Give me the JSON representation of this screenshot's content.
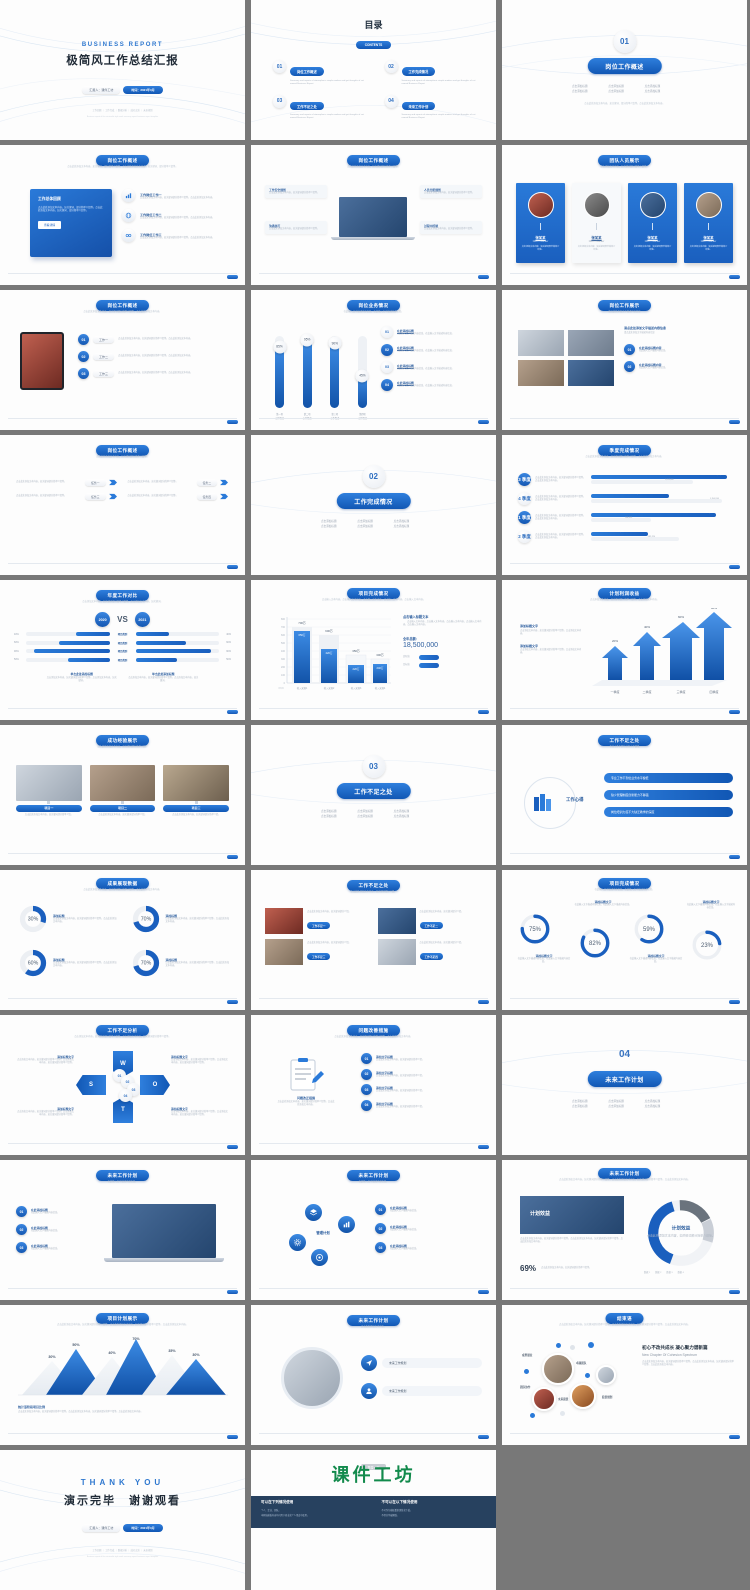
{
  "deck": {
    "background_color": "#787878",
    "accent_blue": "#1f6fd0",
    "accent_dark": "#1157b4"
  },
  "slides": [
    {
      "id": "title",
      "type": "cover",
      "eng_title": "BUSINESS REPORT",
      "cn_title": "极简风工作总结汇报",
      "pill_left": "汇报人：课件工坊",
      "pill_right": "时间：2021年3月",
      "footer": "工作回顾 ｜ 工作完成 ｜ 数据分析 ｜ 成功之处 ｜ 未来规划",
      "footer_sub": "Business report of the minimalist style work summary report business report template"
    },
    {
      "id": "contents",
      "type": "toc",
      "title": "目录",
      "badge": "CONTENTS",
      "items": [
        {
          "num": "01",
          "label": "岗位工作概述",
          "desc": "Summary and reports of atmospheric simple modern and get thoughts of cat named Business Report"
        },
        {
          "num": "02",
          "label": "工作完成情况",
          "desc": "Summary and reports of atmospheric simple modern and get thoughts of cat named Business Report"
        },
        {
          "num": "03",
          "label": "工作不足之处",
          "desc": "Summary and reports of atmospheric simple modern and get thoughts of cat named Business Report"
        },
        {
          "num": "04",
          "label": "未来工作计划",
          "desc": "Summary and reports of atmospheric simple modern and get thoughts of cat named Business Report"
        }
      ]
    },
    {
      "id": "section-01",
      "type": "section",
      "num": "01",
      "title": "岗位工作概述",
      "bullets": [
        "点击添加标题",
        "点击添加标题",
        "点击添加标题",
        "点击添加标题",
        "点击添加标题",
        "点击添加标题"
      ],
      "desc": "点击此处添加文本内容，如关键词、部分简单介绍等。点击此处添加文本内容。"
    },
    {
      "id": "job-overview-card",
      "type": "content",
      "title": "岗位工作概述",
      "card_title": "工作总体回顾",
      "card_text": "点击此处添加文本内容，如关键词、部分简单介绍等。点击此处添加文本内容，如关键词、部分简单介绍等。",
      "card_btn": "查看详情",
      "rows": [
        {
          "label": "工作岗位工作一",
          "desc": "点击此处添加文本内容，如关键词部分简单介绍等。点击此处添加文本内容。",
          "icon": "chart-icon"
        },
        {
          "label": "工作岗位工作二",
          "desc": "点击此处添加文本内容，如关键词部分简单介绍等。点击此处添加文本内容。",
          "icon": "globe-icon"
        },
        {
          "label": "工作岗位工作三",
          "desc": "点击此处添加文本内容，如关键词部分简单介绍等。点击此处添加文本内容。",
          "icon": "link-icon"
        }
      ]
    },
    {
      "id": "job-overview-laptop",
      "type": "content",
      "title": "岗位工作概述",
      "callouts": [
        {
          "label": "工作安全规划",
          "desc": "点击此处添加文本内容，如关键词部分简单介绍等。"
        },
        {
          "label": "人员分配规划",
          "desc": "点击此处添加文本内容，如关键词部分简单介绍等。"
        },
        {
          "label": "沟通技巧",
          "desc": "点击此处添加文本内容，如关键词部分简单介绍等。"
        },
        {
          "label": "过程中控制",
          "desc": "点击此处添加文本内容，如关键词部分简单介绍等。"
        }
      ]
    },
    {
      "id": "team",
      "type": "team",
      "title": "团队人员展示",
      "members": [
        {
          "name": "张某某",
          "role": "CEO / Founder",
          "desc": "点击添加文本内容，如关键词部分简单介绍等。",
          "highlight": true
        },
        {
          "name": "张某某",
          "role": "CEO / Founder",
          "desc": "点击添加文本内容，如关键词部分简单介绍等。",
          "highlight": false
        },
        {
          "name": "张某某",
          "role": "CEO / Founder",
          "desc": "点击添加文本内容，如关键词部分简单介绍等。",
          "highlight": true
        },
        {
          "name": "张某某",
          "role": "CEO / Founder",
          "desc": "点击添加文本内容，如关键词部分简单介绍等。",
          "highlight": true
        }
      ]
    },
    {
      "id": "job-overview-tablet",
      "type": "content",
      "title": "岗位工作概述",
      "rows": [
        {
          "num": "01",
          "label": "工作一",
          "desc": "点击此处添加文本内容，如关键词部分简单介绍等。点击此处添加文本内容。"
        },
        {
          "num": "02",
          "label": "工作二",
          "desc": "点击此处添加文本内容，如关键词部分简单介绍等。点击此处添加文本内容。"
        },
        {
          "num": "03",
          "label": "工作三",
          "desc": "点击此处添加文本内容，如关键词部分简单介绍等。点击此处添加文本内容。"
        }
      ]
    },
    {
      "id": "business-sliders",
      "type": "chart",
      "title": "岗位业务情况",
      "chart_data": {
        "type": "bar",
        "title": "岗位业务情况",
        "categories": [
          "第一项\n工作概述",
          "第二项\n工作概述",
          "第三项\n工作概述",
          "第四项\n工作概述"
        ],
        "values": [
          85,
          95,
          90,
          45
        ],
        "value_labels": [
          "85%",
          "95%",
          "90%",
          "45%"
        ],
        "ylim": [
          0,
          100
        ],
        "ylabel": "",
        "xlabel": ""
      },
      "list": [
        {
          "num": "01",
          "label": "在此添加标题",
          "desc": "在此输入文字描述内容信息，在此输入文字描述内容信息。"
        },
        {
          "num": "02",
          "label": "在此添加标题",
          "desc": "在此输入文字描述内容信息，在此输入文字描述内容信息。"
        },
        {
          "num": "03",
          "label": "在此添加标题",
          "desc": "在此输入文字描述内容信息，在此输入文字描述内容信息。"
        },
        {
          "num": "04",
          "label": "在此添加标题",
          "desc": "在此输入文字描述内容信息，在此输入文字描述内容信息。"
        }
      ]
    },
    {
      "id": "job-photos",
      "type": "content",
      "title": "岗位工作展示",
      "heading": "请点此处添加文字描述内容信息",
      "rows": [
        {
          "num": "01",
          "label": "在此添加标题内容",
          "desc": "在此输入文字描述内容信息。"
        },
        {
          "num": "02",
          "label": "在此添加标题内容",
          "desc": "在此输入文字描述内容信息。"
        }
      ]
    },
    {
      "id": "job-arrows",
      "type": "content",
      "title": "岗位工作概述",
      "rows": [
        {
          "label": "任务一",
          "desc": "点击此处添加文本内容，如关键词部分简单介绍等。"
        },
        {
          "label": "任务二",
          "desc": "点击此处添加文本内容，如关键词部分简单介绍等。"
        },
        {
          "label": "任务三",
          "desc": "点击此处添加文本内容，如关键词部分简单介绍等。"
        },
        {
          "label": "任务四",
          "desc": "点击此处添加文本内容，如关键词部分简单介绍等。"
        }
      ]
    },
    {
      "id": "section-02",
      "type": "section",
      "num": "02",
      "title": "工作完成情况",
      "bullets": [
        "点击添加标题",
        "点击添加标题",
        "点击添加标题",
        "点击添加标题",
        "点击添加标题",
        "点击添加标题"
      ]
    },
    {
      "id": "quarter-completion",
      "type": "chart",
      "title": "季度完成情况",
      "chart_data": {
        "type": "bar",
        "title": "季度完成情况",
        "orientation": "horizontal",
        "categories": [
          "3 季度",
          "4 季度",
          "1 季度",
          "2 季度"
        ],
        "series": [
          {
            "name": "实际完成",
            "values": [
              96,
              55,
              88,
              40
            ],
            "labels": [
              "1,247,448",
              "533,282",
              "861,458",
              "402,128"
            ]
          },
          {
            "name": "计划目标",
            "values": [
              72,
              92,
              42,
              62
            ],
            "labels": [
              "1,058,880",
              "1,156,934",
              "586,331",
              "482,224"
            ]
          }
        ],
        "ylim": [
          0,
          100
        ]
      },
      "rows_desc": "点击此处添加文本内容，如关键词部分简单介绍等。点击此处添加文本内容。"
    },
    {
      "id": "annual-vs",
      "type": "chart",
      "title": "年度工作对比",
      "chart_data": {
        "type": "bar",
        "title": "年度工作对比",
        "orientation": "horizontal-mirror",
        "legend": [
          "2020",
          "2021"
        ],
        "categories": [
          "项目类别",
          "项目类别",
          "项目类别",
          "项目类别"
        ],
        "series": [
          {
            "name": "2020",
            "values": [
              40,
              60,
              90,
              50
            ],
            "labels": [
              "40%",
              "60%",
              "90%",
              "50%"
            ]
          },
          {
            "name": "2021",
            "values": [
              40,
              60,
              90,
              50
            ],
            "labels": [
              "40%",
              "60%",
              "90%",
              "50%"
            ]
          }
        ],
        "ylim": [
          0,
          100
        ]
      },
      "left_head": "单击此处添加标题",
      "right_head": "单击此处添加标题",
      "left_desc": "点击添加文本内容，如关键词部分简单介绍等。点击添加文本内容，如关键词。",
      "right_desc": "点击添加文本内容，如关键词部分简单介绍等。点击添加文本内容，如关键词。"
    },
    {
      "id": "project-completion-bars",
      "type": "chart",
      "title": "项目完成情况",
      "chart_data": {
        "type": "bar",
        "title": "项目完成情况",
        "categories": [
          "收入来源1",
          "收入来源2",
          "收入来源3",
          "收入来源4"
        ],
        "series": [
          {
            "name": "实际值",
            "values": [
              650,
              420,
              220,
              240
            ],
            "labels": [
              "650万",
              "420万",
              "220万",
              "240万"
            ]
          },
          {
            "name": "目标值",
            "values": [
              700,
              600,
              350,
              300
            ],
            "labels": [
              "700万",
              "600万",
              "350万",
              "300万"
            ]
          }
        ],
        "ylim": [
          0,
          800
        ],
        "yticks": [
          0,
          100,
          200,
          300,
          400,
          500,
          600,
          700,
          800
        ],
        "xlabel": "（万元）",
        "legend": [
          "实际值",
          "目标值"
        ]
      },
      "panel_title": "点击输入标题文本",
      "panel_desc": "点击输入文本内容，点击输入文本内容。点击输入文本内容，点击输入文本内容。点击输入文本内容。",
      "total_label": "全年总额：",
      "total_value": "18,500,000"
    },
    {
      "id": "plan-income-arrows",
      "type": "chart",
      "title": "计划利润收益",
      "chart_data": {
        "type": "bar",
        "title": "计划利润收益",
        "categories": [
          "一季度",
          "二季度",
          "三季度",
          "四季度"
        ],
        "values": [
          20,
          40,
          60,
          80
        ],
        "value_labels": [
          "20%",
          "40%",
          "60%",
          "80%"
        ],
        "ylim": [
          0,
          100
        ]
      },
      "blocks": [
        {
          "head": "添加标题文字",
          "desc": "点击添加文本内容，如关键词部分简单介绍等。点击添加文本内容。"
        },
        {
          "head": "添加标题文字",
          "desc": "点击添加文本内容，如关键词部分简单介绍等。点击添加文本内容。"
        }
      ]
    },
    {
      "id": "achievements",
      "type": "content",
      "title": "成功经验展示",
      "cards": [
        {
          "label": "项目一",
          "desc": "点击此处添加文本内容，如关键词部分简单介绍。"
        },
        {
          "label": "项目二",
          "desc": "点击此处添加文本内容，如关键词部分简单介绍。"
        },
        {
          "label": "项目三",
          "desc": "点击此处添加文本内容，如关键词部分简单介绍。"
        }
      ]
    },
    {
      "id": "section-03",
      "type": "section",
      "num": "03",
      "title": "工作不足之处",
      "bullets": [
        "点击添加标题",
        "点击添加标题",
        "点击添加标题",
        "点击添加标题",
        "点击添加标题",
        "点击添加标题"
      ]
    },
    {
      "id": "work-insights",
      "type": "content",
      "title": "工作不足之处",
      "center_label": "工作心得",
      "rows": [
        {
          "text": "专业工作不到位业务水平偏低"
        },
        {
          "text": "缺少管理制度创新能力不够强"
        },
        {
          "text": "岗位培训力度不大缺乏教学的深度"
        }
      ]
    },
    {
      "id": "donut-four",
      "type": "chart",
      "title": "成果展现数据",
      "chart_data": {
        "type": "pie",
        "title": "成果展现数据",
        "labels": [
          "添加标题",
          "添加标题",
          "添加标题",
          "添加标题"
        ],
        "values": [
          30,
          70,
          60,
          70
        ],
        "value_labels": [
          "30%",
          "70%",
          "60%",
          "70%"
        ],
        "desc": "点击此处添加文本内容，如关键词部分简单介绍等。点击此处添加文本内容。"
      }
    },
    {
      "id": "shortcomings-photos",
      "type": "content",
      "title": "工作不足之处",
      "cards": [
        {
          "label": "工作不足一",
          "desc": "点击此处添加文本内容，如关键词部分介绍。"
        },
        {
          "label": "工作不足二",
          "desc": "点击此处添加文本内容，如关键词部分介绍。"
        },
        {
          "label": "工作不足三",
          "desc": "点击此处添加文本内容，如关键词部分介绍。"
        },
        {
          "label": "工作不足四",
          "desc": "点击此处添加文本内容，如关键词部分介绍。"
        }
      ]
    },
    {
      "id": "rings-four",
      "type": "chart",
      "title": "项目完成情况",
      "chart_data": {
        "type": "pie",
        "title": "项目完成情况",
        "labels": [
          "添加标题文字",
          "添加标题文字",
          "添加标题文字",
          "添加标题文字"
        ],
        "values": [
          75,
          82,
          59,
          23
        ],
        "value_labels": [
          "75%",
          "82%",
          "59%",
          "23%"
        ],
        "desc": "在此输入文字描述内容信息，在此输入文字描述内容信息。"
      }
    },
    {
      "id": "swot",
      "type": "diagram",
      "title": "工作不足分析",
      "letters": [
        "W",
        "S",
        "O",
        "T"
      ],
      "center_nums": [
        "01",
        "02",
        "03",
        "04"
      ],
      "blocks": [
        {
          "head": "添加标题文字",
          "desc": "点击添加文本内容，如关键词部分简单介绍等。点击添加文本内容，如关键词部分简单介绍等。"
        },
        {
          "head": "添加标题文字",
          "desc": "点击添加文本内容，如关键词部分简单介绍等。点击添加文本内容，如关键词部分简单介绍等。"
        },
        {
          "head": "添加标题文字",
          "desc": "点击添加文本内容，如关键词部分简单介绍等。点击添加文本内容，如关键词部分简单介绍等。"
        },
        {
          "head": "添加标题文字",
          "desc": "点击添加文本内容，如关键词部分简单介绍等。点击添加文本内容，如关键词部分简单介绍等。"
        }
      ]
    },
    {
      "id": "problem-list",
      "type": "content",
      "title": "问题改善措施",
      "panel_label": "问题改正措施",
      "panel_desc": "点击此处添加文本内容，如关键词部分简单介绍等。点击此处添加文本内容。",
      "rows": [
        {
          "num": "01",
          "label": "添加文字标题",
          "desc": "点击此处添加文本内容，如关键词部分简单介绍。"
        },
        {
          "num": "02",
          "label": "添加文字标题",
          "desc": "点击此处添加文本内容，如关键词部分简单介绍。"
        },
        {
          "num": "03",
          "label": "添加文字标题",
          "desc": "点击此处添加文本内容，如关键词部分简单介绍。"
        },
        {
          "num": "04",
          "label": "添加文字标题",
          "desc": "点击此处添加文本内容，如关键词部分简单介绍。"
        }
      ]
    },
    {
      "id": "section-04",
      "type": "section",
      "num": "04",
      "title": "未来工作计划",
      "bullets": [
        "点击添加标题",
        "点击添加标题",
        "点击添加标题",
        "点击添加标题",
        "点击添加标题",
        "点击添加标题"
      ]
    },
    {
      "id": "future-laptop",
      "type": "content",
      "title": "未来工作计划",
      "rows": [
        {
          "num": "01",
          "label": "在此添加标题",
          "desc": "在此输入文字描述内容信息。"
        },
        {
          "num": "02",
          "label": "在此添加标题",
          "desc": "在此输入文字描述内容信息。"
        },
        {
          "num": "03",
          "label": "在此添加标题",
          "desc": "在此输入文字描述内容信息。"
        }
      ]
    },
    {
      "id": "future-icons",
      "type": "content",
      "title": "未来工作计划",
      "center_label": "管理计划",
      "rows": [
        {
          "num": "01",
          "label": "在此添加标题",
          "desc": "在此输入文字描述内容信息。"
        },
        {
          "num": "02",
          "label": "在此添加标题",
          "desc": "在此输入文字描述内容信息。"
        },
        {
          "num": "03",
          "label": "在此添加标题",
          "desc": "在此输入文字描述内容信息。"
        }
      ]
    },
    {
      "id": "future-donut-69",
      "type": "chart",
      "title": "未来工作计划",
      "photo_label": "计划效益",
      "body": "点击此处添加文本内容，如关键词部分简单介绍等。点击此处添加文本内容，如关键词部分简单介绍等。点击此处添加文本内容。",
      "chart_data": {
        "type": "pie",
        "title": "计划效益",
        "labels": [
          "数据 1",
          "数据 2",
          "数据 3",
          "数据 4"
        ],
        "values": [
          40,
          18,
          12,
          30
        ],
        "highlight_label": "69%",
        "center_title": "计划效益",
        "center_desc": "点击此处添加文本内容，如关键词部分简单介绍等。"
      },
      "percent": "69%",
      "percent_desc": "点击此处添加文本内容，如关键词部分简单介绍等。"
    },
    {
      "id": "plan-triangles",
      "type": "chart",
      "title": "项目计划展示",
      "chart_data": {
        "type": "area",
        "title": "项目计划展示",
        "categories": [
          "1",
          "2",
          "3",
          "4",
          "5",
          "6"
        ],
        "values": [
          30,
          50,
          40,
          70,
          35,
          30
        ],
        "value_labels": [
          "30%",
          "50%",
          "40%",
          "70%",
          "35%",
          "30%"
        ],
        "ylim": [
          0,
          100
        ]
      },
      "footer_head": "统计该阶段项目比例",
      "footer_desc": "点击此处添加文本内容，如关键词部分简单介绍等。点击此处添加文本内容，如关键词部分简单介绍等。点击此处添加文本内容。"
    },
    {
      "id": "future-steps",
      "type": "content",
      "title": "未来工作计划",
      "rows": [
        {
          "label": "未来工作规划",
          "desc": "点击此处添加文本内容。"
        },
        {
          "label": "未来工作规划",
          "desc": "点击此处添加文本内容。"
        }
      ]
    },
    {
      "id": "closing",
      "type": "content",
      "title": "结束语",
      "headline": "初心不改共成长  凝心聚力谱新篇",
      "headline_en": "New Chapter Of Cohesion Spectrum",
      "body": "点击此处添加文本内容，如关键词部分简单介绍等。点击此处添加文本内容，如关键词部分简单介绍等。点击此处添加文本内容。",
      "tags": [
        "成果展业",
        "卓越团队",
        "团队协作",
        "未来愿景",
        "愿景规划"
      ]
    },
    {
      "id": "thankyou",
      "type": "cover",
      "eng_title": "THANK YOU",
      "cn_title": "演示完毕　谢谢观看",
      "pill_left": "汇报人：课件工坊",
      "pill_right": "时间：2021年3月",
      "footer": "工作回顾 ｜ 工作完成 ｜ 数据分析 ｜ 成功之处 ｜ 未来规划",
      "footer_sub": "Business report of the minimalist style work summary report business report template"
    },
    {
      "id": "branding",
      "type": "brand",
      "badge": "百度一下",
      "logo": "课件工坊",
      "left_head": "可以在下列情况使用",
      "left_items": [
        "个人、企业、团队。",
        "本网站模板内容均可用于商业或个人用途中使用。"
      ],
      "right_head": "不可以在以下情况使用",
      "right_items": [
        "不可作为模板重新销售或下载。",
        "不得分享破解版。"
      ]
    }
  ]
}
